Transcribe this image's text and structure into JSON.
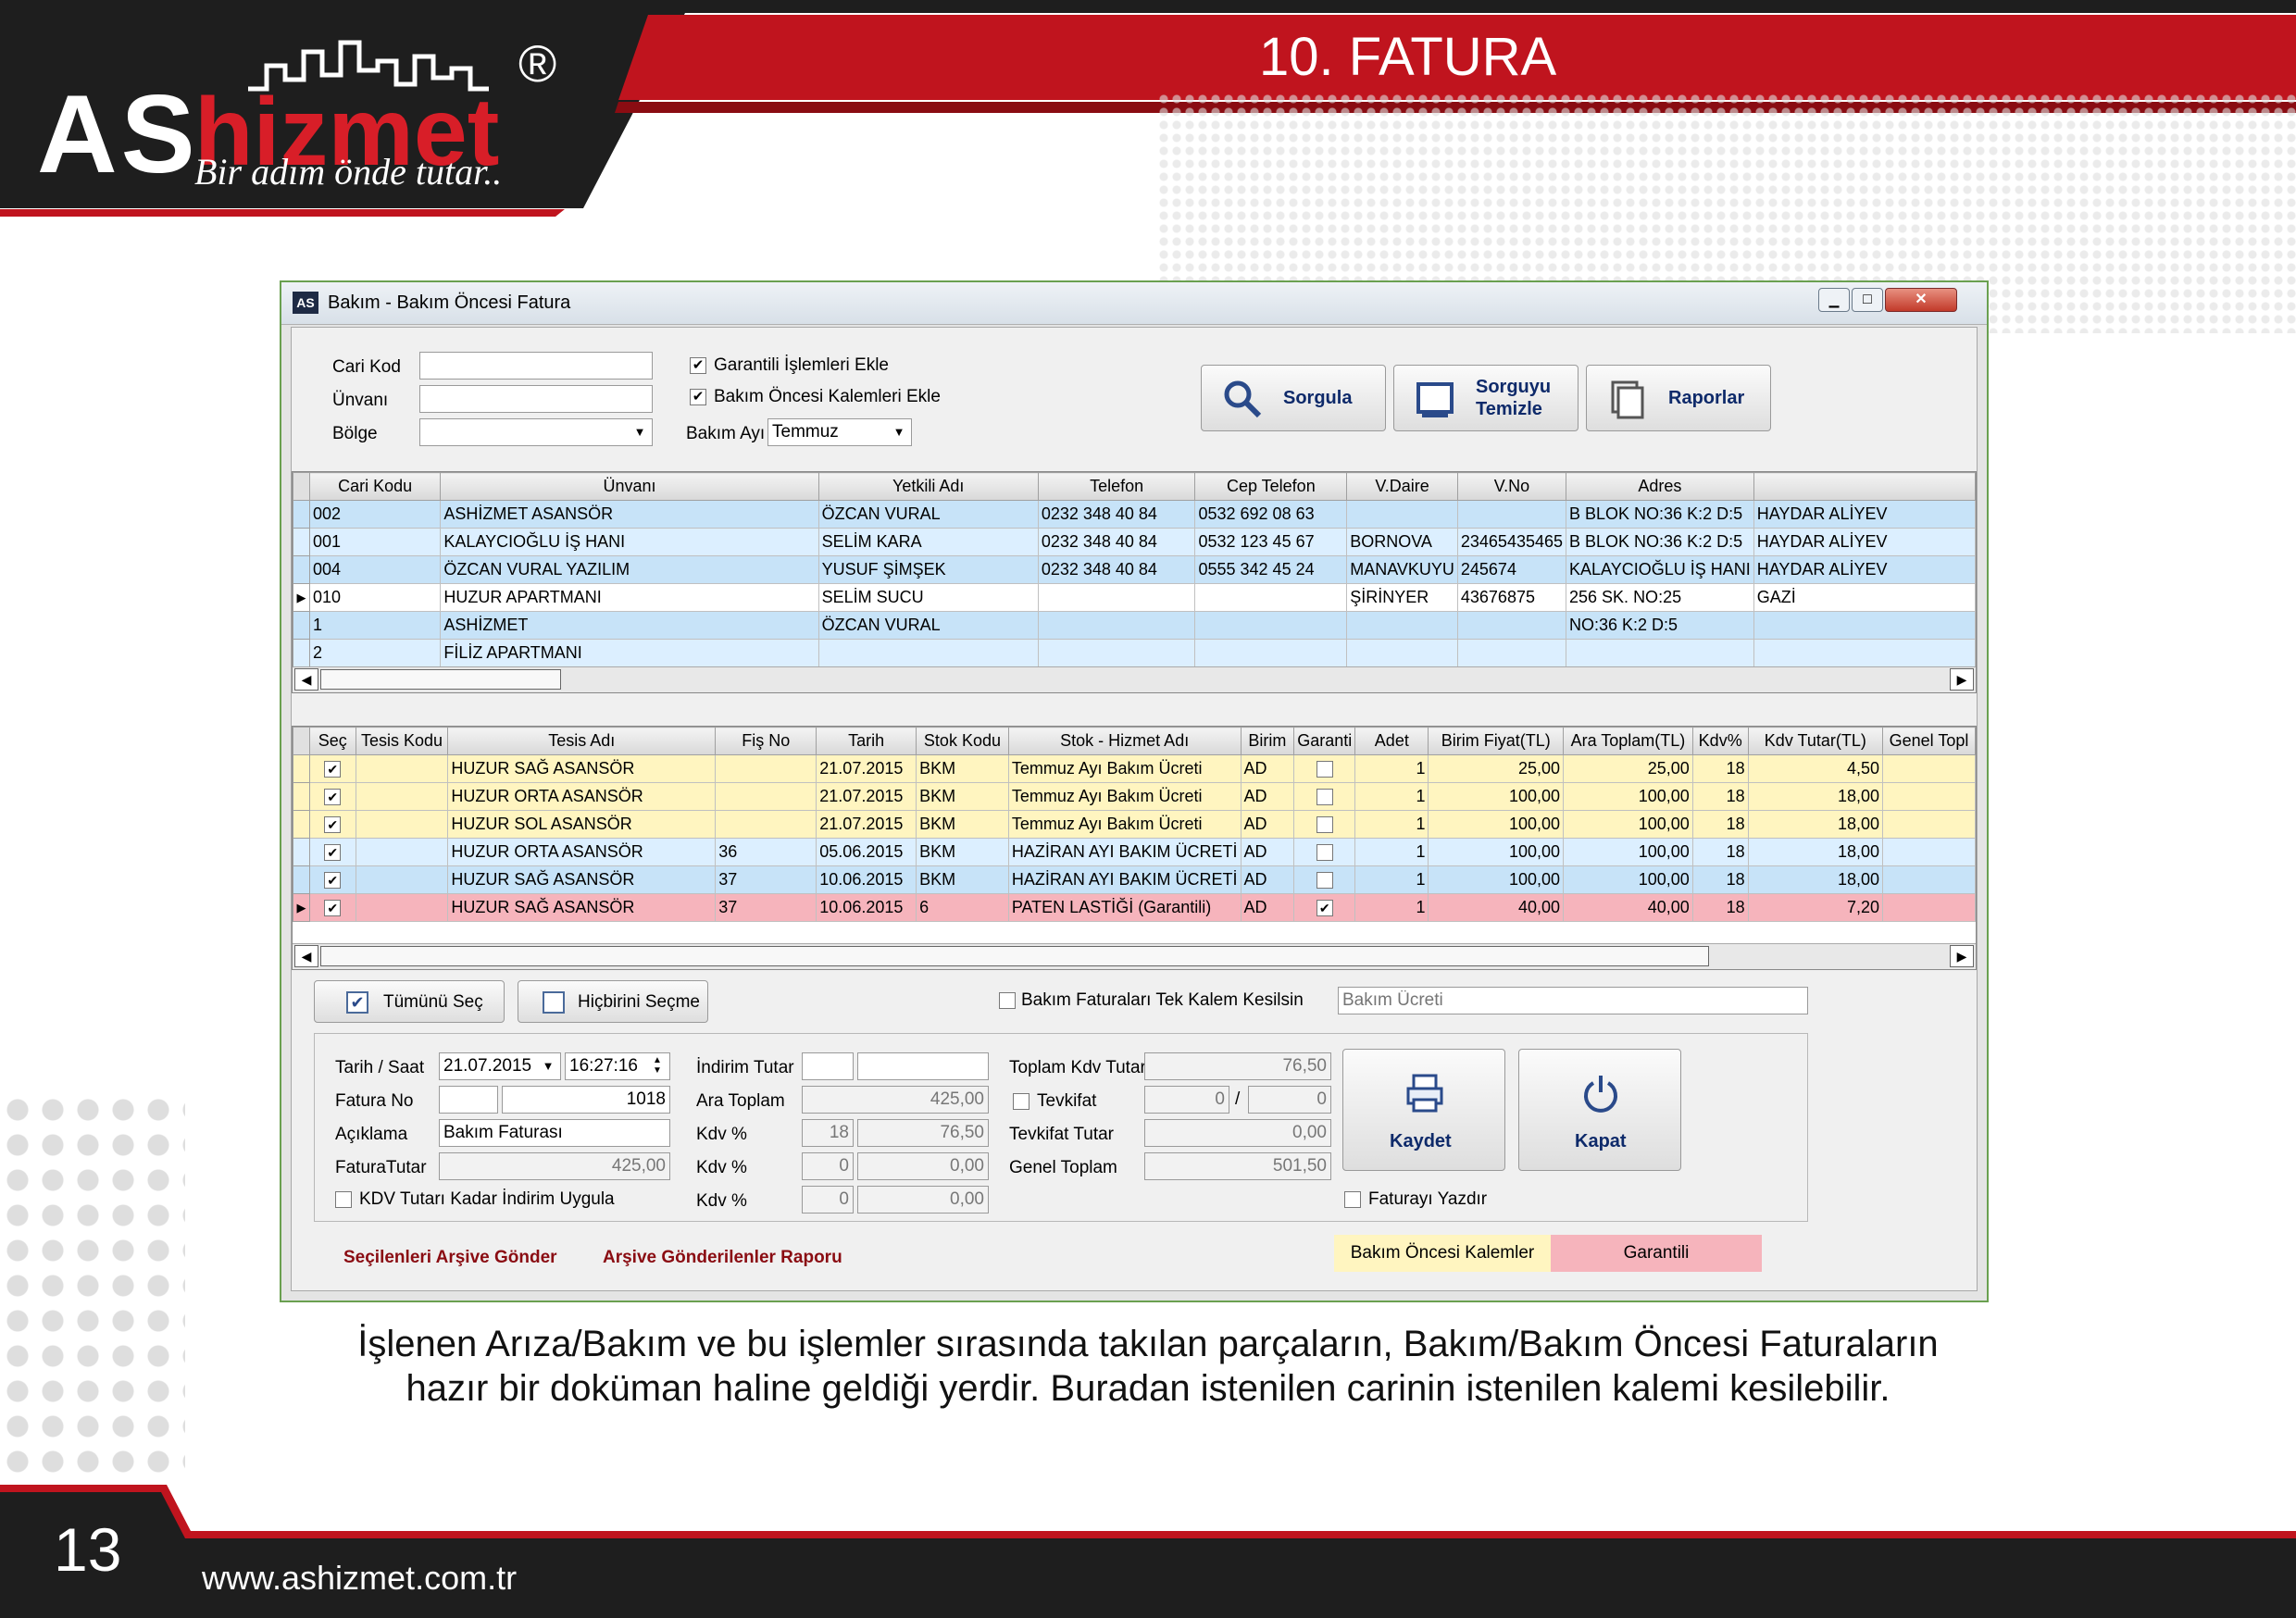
{
  "header": {
    "logo": {
      "brand_as": "AS",
      "brand_hizmet": "hizmet",
      "registered": "®",
      "slogan": "Bir adım önde tutar.."
    },
    "title": "10. FATURA"
  },
  "window": {
    "title": "Bakım - Bakım Öncesi Fatura",
    "app_icon": "AS",
    "controls": {
      "minimize": "▁",
      "maximize": "□",
      "close": "✕"
    }
  },
  "filters": {
    "cari_kod_label": "Cari Kod",
    "cari_kod_value": "",
    "unvani_label": "Ünvanı",
    "unvani_value": "",
    "bolge_label": "Bölge",
    "bolge_value": "",
    "garantili_label": "Garantili İşlemleri Ekle",
    "garantili_checked": true,
    "bakim_oncesi_label": "Bakım Öncesi Kalemleri Ekle",
    "bakim_oncesi_checked": true,
    "bakim_ayi_label": "Bakım Ayı",
    "bakim_ayi_value": "Temmuz"
  },
  "toolbar": {
    "sorgula": "Sorgula",
    "sorguyu_line1": "Sorguyu",
    "sorguyu_line2": "Temizle",
    "raporlar": "Raporlar"
  },
  "customers": {
    "columns": [
      "Cari Kodu",
      "Ünvanı",
      "Yetkili Adı",
      "Telefon",
      "Cep Telefon",
      "V.Daire",
      "V.No",
      "Adres",
      ""
    ],
    "rows": [
      [
        "002",
        "ASHİZMET ASANSÖR",
        "ÖZCAN VURAL",
        "0232 348 40 84",
        "0532 692 08 63",
        "",
        "",
        "B BLOK NO:36 K:2 D:5",
        "HAYDAR ALİYEV"
      ],
      [
        "001",
        "KALAYCIOĞLU İŞ HANI",
        "SELİM KARA",
        "0232 348 40 84",
        "0532 123 45 67",
        "BORNOVA",
        "23465435465",
        "B BLOK NO:36 K:2 D:5",
        "HAYDAR ALİYEV"
      ],
      [
        "004",
        "ÖZCAN VURAL YAZILIM",
        "YUSUF ŞİMŞEK",
        "0232 348 40 84",
        "0555 342 45 24",
        "MANAVKUYU",
        "245674",
        "KALAYCIOĞLU İŞ HANI",
        "HAYDAR ALİYEV"
      ],
      [
        "010",
        "HUZUR APARTMANI",
        "SELİM SUCU",
        "",
        "",
        "ŞİRİNYER",
        "43676875",
        "256 SK. NO:25",
        "GAZİ"
      ],
      [
        "1",
        "ASHİZMET",
        "ÖZCAN VURAL",
        "",
        "",
        "",
        "",
        "NO:36 K:2 D:5",
        ""
      ],
      [
        "2",
        "FİLİZ APARTMANI",
        "",
        "",
        "",
        "",
        "",
        "",
        ""
      ]
    ]
  },
  "items": {
    "columns": [
      "Seç",
      "Tesis Kodu",
      "Tesis Adı",
      "Fiş No",
      "Tarih",
      "Stok Kodu",
      "Stok - Hizmet Adı",
      "Birim",
      "Garanti",
      "Adet",
      "Birim Fiyat(TL)",
      "Ara Toplam(TL)",
      "Kdv%",
      "Kdv Tutar(TL)",
      "Genel Topl"
    ],
    "rows": [
      {
        "sec": "✔",
        "tesis_kodu": "",
        "tesis_adi": "HUZUR SAĞ ASANSÖR",
        "fis_no": "",
        "tarih": "21.07.2015",
        "stok_kodu": "BKM",
        "stok_adi": "Temmuz Ayı Bakım Ücreti",
        "birim": "AD",
        "garanti": "",
        "adet": "1",
        "birim_fiyat": "25,00",
        "ara_toplam": "25,00",
        "kdv": "18",
        "kdv_tutar": "4,50",
        "genel": ""
      },
      {
        "sec": "✔",
        "tesis_kodu": "",
        "tesis_adi": "HUZUR ORTA  ASANSÖR",
        "fis_no": "",
        "tarih": "21.07.2015",
        "stok_kodu": "BKM",
        "stok_adi": "Temmuz Ayı Bakım Ücreti",
        "birim": "AD",
        "garanti": "",
        "adet": "1",
        "birim_fiyat": "100,00",
        "ara_toplam": "100,00",
        "kdv": "18",
        "kdv_tutar": "18,00",
        "genel": ""
      },
      {
        "sec": "✔",
        "tesis_kodu": "",
        "tesis_adi": "HUZUR SOL  ASANSÖR",
        "fis_no": "",
        "tarih": "21.07.2015",
        "stok_kodu": "BKM",
        "stok_adi": "Temmuz Ayı Bakım Ücreti",
        "birim": "AD",
        "garanti": "",
        "adet": "1",
        "birim_fiyat": "100,00",
        "ara_toplam": "100,00",
        "kdv": "18",
        "kdv_tutar": "18,00",
        "genel": ""
      },
      {
        "sec": "✔",
        "tesis_kodu": "",
        "tesis_adi": "HUZUR ORTA  ASANSÖR",
        "fis_no": "36",
        "tarih": "05.06.2015",
        "stok_kodu": "BKM",
        "stok_adi": "HAZİRAN AYI BAKIM ÜCRETİ",
        "birim": "AD",
        "garanti": "",
        "adet": "1",
        "birim_fiyat": "100,00",
        "ara_toplam": "100,00",
        "kdv": "18",
        "kdv_tutar": "18,00",
        "genel": ""
      },
      {
        "sec": "✔",
        "tesis_kodu": "",
        "tesis_adi": "HUZUR SAĞ ASANSÖR",
        "fis_no": "37",
        "tarih": "10.06.2015",
        "stok_kodu": "BKM",
        "stok_adi": "HAZİRAN AYI BAKIM ÜCRETİ",
        "birim": "AD",
        "garanti": "",
        "adet": "1",
        "birim_fiyat": "100,00",
        "ara_toplam": "100,00",
        "kdv": "18",
        "kdv_tutar": "18,00",
        "genel": ""
      },
      {
        "sec": "✔",
        "tesis_kodu": "",
        "tesis_adi": "HUZUR SAĞ ASANSÖR",
        "fis_no": "37",
        "tarih": "10.06.2015",
        "stok_kodu": "6",
        "stok_adi": "PATEN LASTİĞİ (Garantili)",
        "birim": "AD",
        "garanti": "✔",
        "adet": "1",
        "birim_fiyat": "40,00",
        "ara_toplam": "40,00",
        "kdv": "18",
        "kdv_tutar": "7,20",
        "genel": ""
      }
    ]
  },
  "selection": {
    "tumunu_sec": "Tümünü Seç",
    "hicbirini_secme": "Hiçbirini Seçme",
    "tek_kalem_label": "Bakım Faturaları Tek Kalem Kesilsin",
    "tek_kalem_placeholder": "Bakım Ücreti"
  },
  "form": {
    "tarih_label": "Tarih / Saat",
    "tarih_value": "21.07.2015",
    "saat_value": "16:27:16",
    "fatura_no_label": "Fatura No",
    "fatura_seri": "",
    "fatura_no_value": "1018",
    "aciklama_label": "Açıklama",
    "aciklama_value": "Bakım Faturası",
    "fatura_tutar_label": "FaturaTutar",
    "fatura_tutar_value": "425,00",
    "kdv_indirim_label": "KDV Tutarı Kadar İndirim Uygula",
    "indirim_label": "İndirim Tutar",
    "indirim_value1": "",
    "indirim_value2": "",
    "ara_toplam_label": "Ara Toplam",
    "ara_toplam_value": "425,00",
    "kdv_label": "Kdv %",
    "kdv_rows": [
      [
        "18",
        "76,50"
      ],
      [
        "0",
        "0,00"
      ],
      [
        "0",
        "0,00"
      ]
    ],
    "toplam_kdv_label": "Toplam Kdv Tutar",
    "toplam_kdv_value": "76,50",
    "tevkifat_label": "Tevkifat",
    "tevkifat_num": "0",
    "tevkifat_sep": "/",
    "tevkifat_den": "0",
    "tevkifat_tutar_label": "Tevkifat Tutar",
    "tevkifat_tutar_value": "0,00",
    "genel_toplam_label": "Genel Toplam",
    "genel_toplam_value": "501,50",
    "kaydet": "Kaydet",
    "kapat": "Kapat",
    "fatura_yazdir_label": "Faturayı Yazdır"
  },
  "footer_links": {
    "arsive_gonder": "Seçilenleri Arşive Gönder",
    "arsiv_raporu": "Arşive Gönderilenler Raporu"
  },
  "legend": {
    "bakim_oncesi": "Bakım Öncesi Kalemler",
    "garantili": "Garantili"
  },
  "description": {
    "line1": "İşlenen  Arıza/Bakım ve bu işlemler sırasında takılan parçaların, Bakım/Bakım Öncesi Faturaların",
    "line2": "hazır bir doküman haline geldiği yerdir. Buradan istenilen carinin istenilen kalemi kesilebilir."
  },
  "page_footer": {
    "page_number": "13",
    "url": "www.ashizmet.com.tr"
  },
  "colors": {
    "brand_red": "#c0141e",
    "dark": "#1e1e1e",
    "row_yellow": "#fff5c0",
    "row_red": "#f6b4bc",
    "row_blue": "#c7e3f8"
  }
}
